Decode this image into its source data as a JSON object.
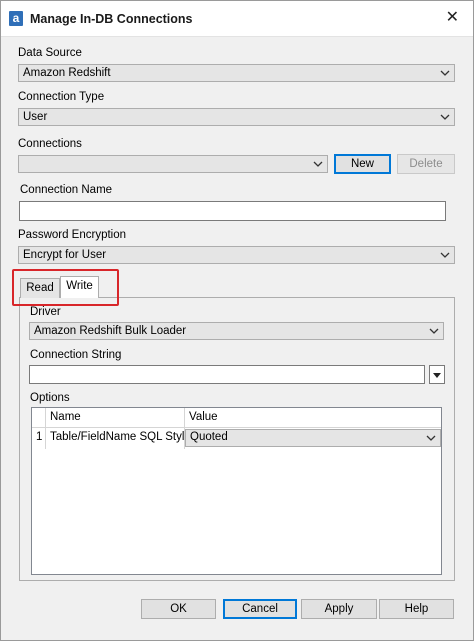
{
  "window": {
    "title": "Manage In-DB Connections",
    "app_icon_letter": "a",
    "close_glyph": "✕"
  },
  "data_source": {
    "label": "Data Source",
    "value": "Amazon Redshift"
  },
  "connection_type": {
    "label": "Connection Type",
    "value": "User"
  },
  "connections": {
    "label": "Connections",
    "value": "",
    "new_label": "New",
    "delete_label": "Delete"
  },
  "connection_name": {
    "label": "Connection Name",
    "value": ""
  },
  "password_encryption": {
    "label": "Password Encryption",
    "value": "Encrypt for User"
  },
  "tabs": [
    {
      "label": "Read",
      "selected": false
    },
    {
      "label": "Write",
      "selected": true
    }
  ],
  "write": {
    "driver": {
      "label": "Driver",
      "value": "Amazon Redshift Bulk Loader"
    },
    "connection_string": {
      "label": "Connection String",
      "value": ""
    },
    "options": {
      "label": "Options",
      "columns": [
        "Name",
        "Value"
      ],
      "rows": [
        {
          "index": "1",
          "name": "Table/FieldName SQL Style",
          "value": "Quoted"
        }
      ]
    }
  },
  "footer": {
    "ok": "OK",
    "cancel": "Cancel",
    "apply": "Apply",
    "help": "Help"
  },
  "colors": {
    "dialog_bg": "#f0f0f0",
    "highlight": "#d8262a",
    "focus_border": "#0078d7",
    "app_icon": "#2f6fb8"
  },
  "icons": {
    "combo_arrow": "chevron-down-icon",
    "app": "alteryx-icon",
    "close": "close-icon"
  }
}
